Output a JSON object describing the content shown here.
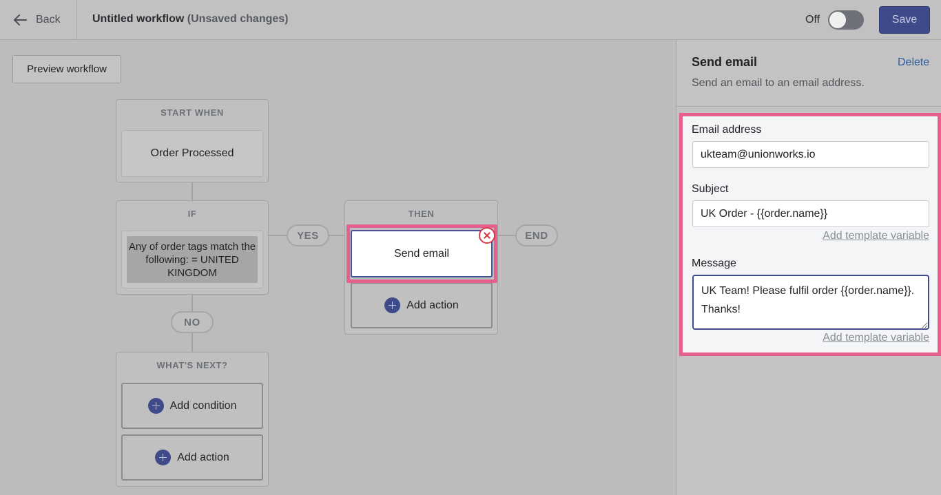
{
  "topbar": {
    "back_label": "Back",
    "title": "Untitled workflow",
    "unsaved_note": "(Unsaved changes)",
    "toggle_label": "Off",
    "toggle_state": "off",
    "save_label": "Save"
  },
  "canvas": {
    "preview_label": "Preview workflow",
    "start": {
      "header": "START WHEN",
      "trigger": "Order Processed"
    },
    "if_block": {
      "header": "IF",
      "condition": "Any of order tags match the following: = UNITED KINGDOM"
    },
    "yes_label": "YES",
    "no_label": "NO",
    "end_label": "END",
    "then_block": {
      "header": "THEN",
      "action": "Send email",
      "add_action": "Add action"
    },
    "next_block": {
      "header": "WHAT'S NEXT?",
      "add_condition": "Add condition",
      "add_action": "Add action"
    }
  },
  "panel": {
    "title": "Send email",
    "delete_label": "Delete",
    "description": "Send an email to an email address.",
    "email": {
      "label": "Email address",
      "value": "ukteam@unionworks.io"
    },
    "subject": {
      "label": "Subject",
      "value": "UK Order - {{order.name}}",
      "link": "Add template variable"
    },
    "message": {
      "label": "Message",
      "value": "UK Team! Please fulfil order {{order.name}}.\nThanks!",
      "link": "Add template variable"
    }
  },
  "colors": {
    "accent": "#3e4a8a",
    "highlight": "#e55f8f",
    "delete_link": "#2c5e9c",
    "error": "#d23a45"
  }
}
